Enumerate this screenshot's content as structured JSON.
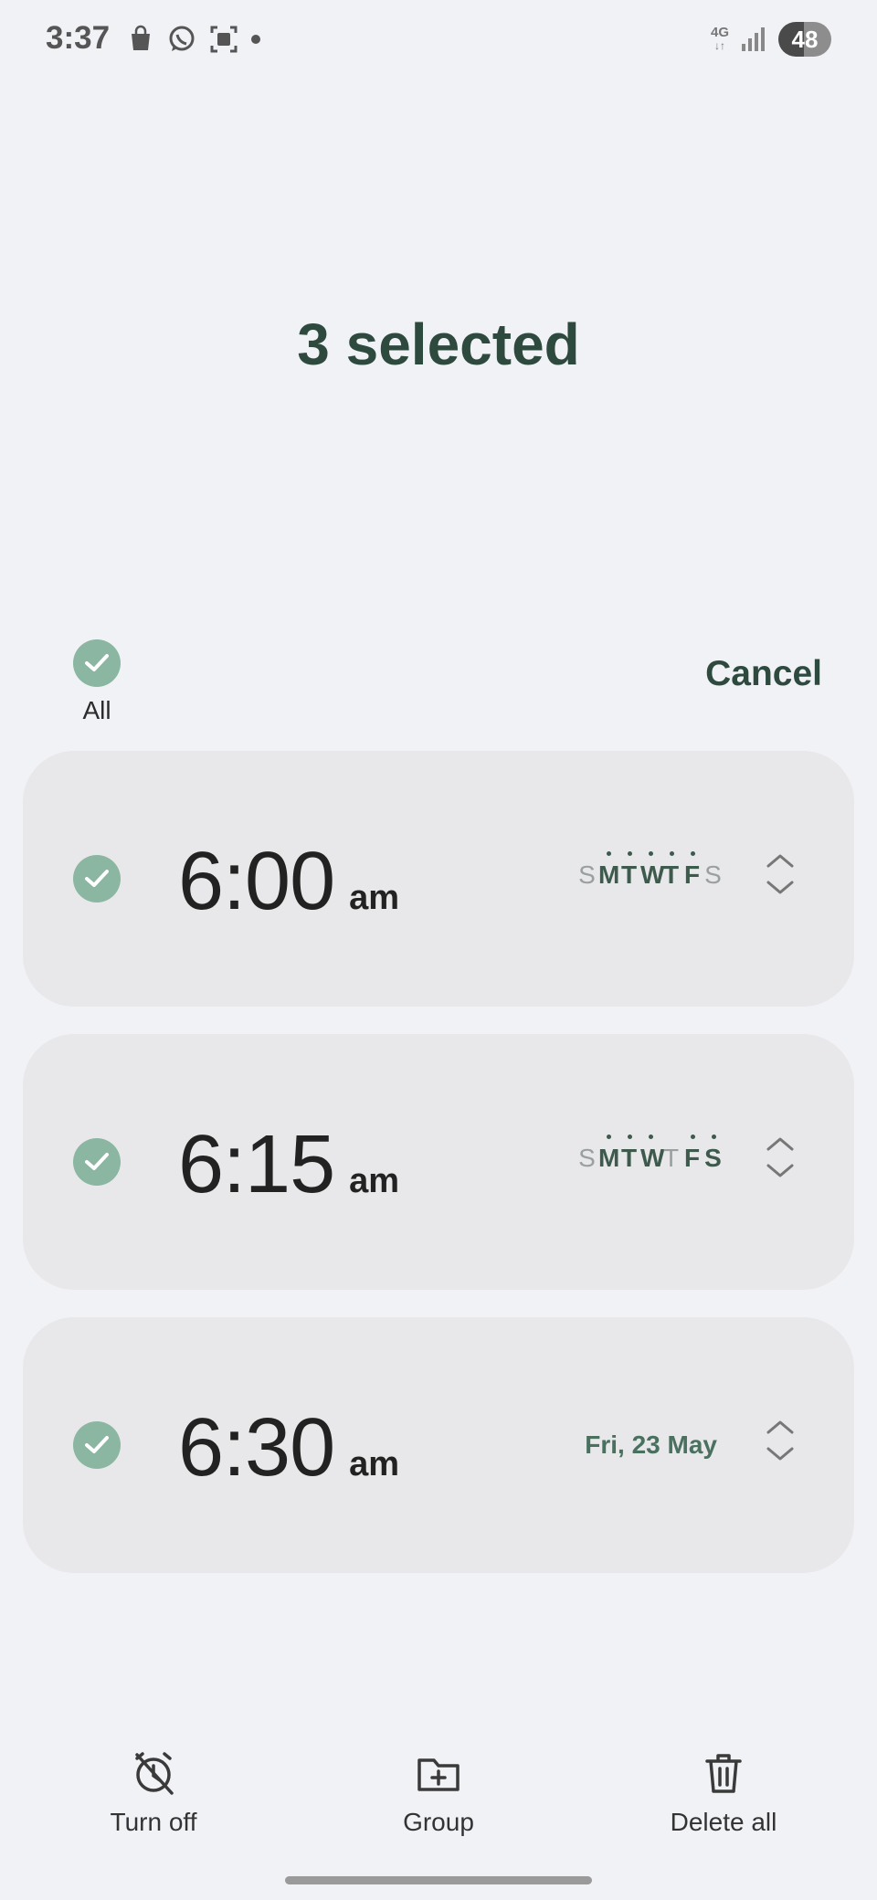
{
  "status_bar": {
    "time": "3:37",
    "network": "4G",
    "battery": "48",
    "left_icons": [
      "shopping-bag-icon",
      "whatsapp-icon",
      "screenshot-icon",
      "dot-icon"
    ]
  },
  "header": {
    "title": "3 selected"
  },
  "selection": {
    "all_label": "All",
    "cancel_label": "Cancel"
  },
  "alarms": [
    {
      "time": "6:00",
      "ampm": "am",
      "selected": true,
      "days": [
        {
          "letter": "S",
          "active": false
        },
        {
          "letter": "M",
          "active": true
        },
        {
          "letter": "T",
          "active": true
        },
        {
          "letter": "W",
          "active": true
        },
        {
          "letter": "T",
          "active": true
        },
        {
          "letter": "F",
          "active": true
        },
        {
          "letter": "S",
          "active": false
        }
      ]
    },
    {
      "time": "6:15",
      "ampm": "am",
      "selected": true,
      "days": [
        {
          "letter": "S",
          "active": false
        },
        {
          "letter": "M",
          "active": true
        },
        {
          "letter": "T",
          "active": true
        },
        {
          "letter": "W",
          "active": true
        },
        {
          "letter": "T",
          "active": false
        },
        {
          "letter": "F",
          "active": true
        },
        {
          "letter": "S",
          "active": true
        }
      ]
    },
    {
      "time": "6:30",
      "ampm": "am",
      "selected": true,
      "date": "Fri, 23 May"
    }
  ],
  "bottom_actions": {
    "turn_off": "Turn off",
    "group": "Group",
    "delete_all": "Delete all"
  },
  "colors": {
    "accent": "#8ab6a2",
    "title": "#2e4a3f",
    "background": "#f1f2f6",
    "card": "#e8e8ea"
  }
}
